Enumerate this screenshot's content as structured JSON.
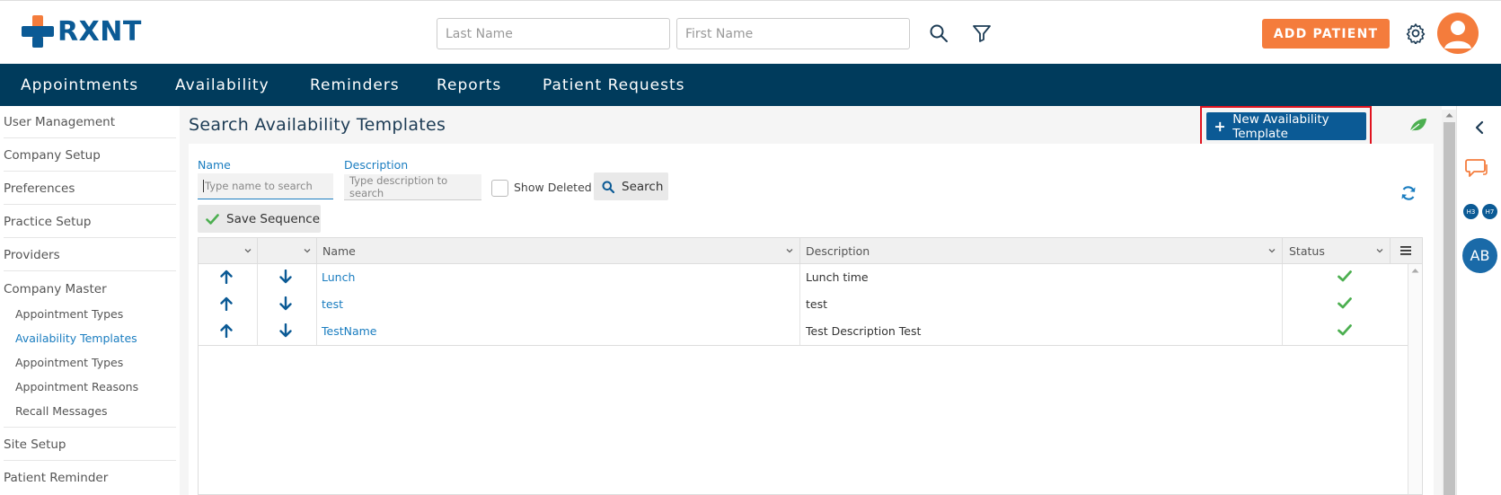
{
  "brand": {
    "name": "RXNT"
  },
  "header": {
    "last_name_placeholder": "Last Name",
    "first_name_placeholder": "First Name",
    "add_patient_label": "ADD PATIENT",
    "colors": {
      "accent": "#f47c3c",
      "brand": "#0b5a95",
      "nav_bg": "#003b5c"
    }
  },
  "nav": {
    "items": [
      {
        "label": "Appointments"
      },
      {
        "label": "Availability"
      },
      {
        "label": "Reminders"
      },
      {
        "label": "Reports"
      },
      {
        "label": "Patient Requests"
      }
    ]
  },
  "sidebar": {
    "items": [
      {
        "label": "User Management"
      },
      {
        "label": "Company Setup"
      },
      {
        "label": "Preferences"
      },
      {
        "label": "Practice Setup"
      },
      {
        "label": "Providers"
      },
      {
        "label": "Company Master"
      }
    ],
    "sub_items": [
      {
        "label": "Appointment Types"
      },
      {
        "label": "Availability Templates"
      },
      {
        "label": "Appointment Types"
      },
      {
        "label": "Appointment Reasons"
      },
      {
        "label": "Recall Messages"
      }
    ],
    "bottom_items": [
      {
        "label": "Site Setup"
      },
      {
        "label": "Patient Reminder"
      }
    ]
  },
  "main": {
    "title": "Search Availability Templates",
    "new_template_label": "New Availability Template",
    "filters": {
      "name_label": "Name",
      "name_placeholder": "Type name to search",
      "description_label": "Description",
      "description_placeholder": "Type description to search",
      "show_deleted_label": "Show Deleted",
      "search_label": "Search",
      "save_sequence_label": "Save Sequence"
    },
    "grid": {
      "columns": [
        "Name",
        "Description",
        "Status"
      ],
      "rows": [
        {
          "name": "Lunch",
          "description": "Lunch time"
        },
        {
          "name": "test",
          "description": "test"
        },
        {
          "name": "TestName",
          "description": "Test Description Test"
        }
      ]
    }
  },
  "rail": {
    "badge_1": "H3",
    "badge_2": "H7",
    "avatar_initials": "AB"
  }
}
